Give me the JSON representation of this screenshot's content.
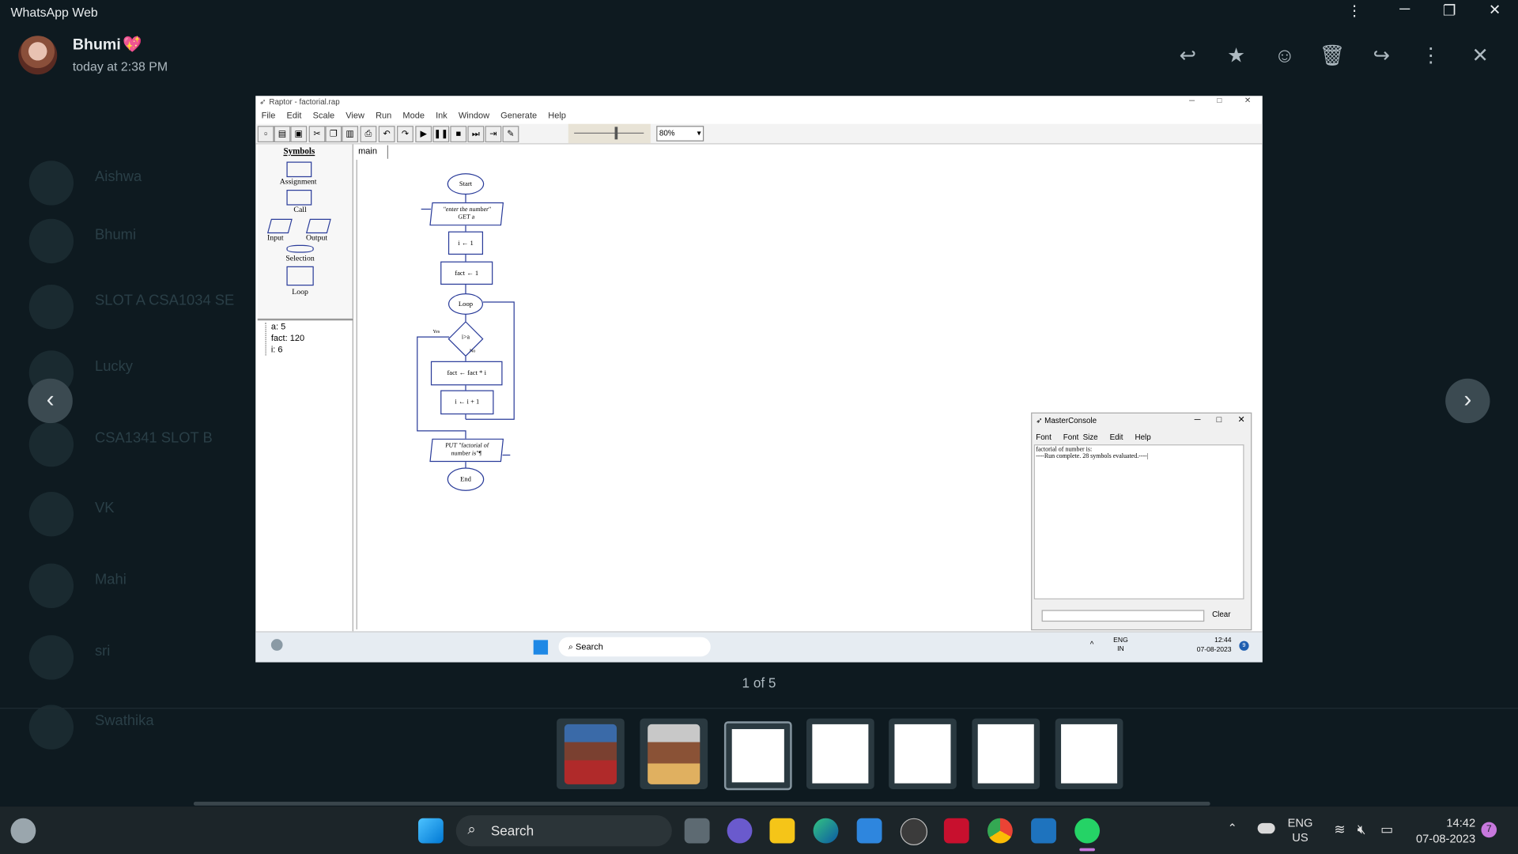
{
  "app": {
    "title": "WhatsApp Web"
  },
  "background_chats": [
    "Aishwa",
    "Bhumi",
    "SLOT A CSA1034 SE",
    "Lucky",
    "CSA1341 SLOT B",
    "VK",
    "Mahi",
    "sri",
    "Swathika"
  ],
  "header": {
    "sender_name": "Bhumi",
    "sender_emoji": "💖",
    "timestamp": "today at 2:38 PM",
    "actions": [
      {
        "name": "reply-icon",
        "glyph": "↩"
      },
      {
        "name": "star-icon",
        "glyph": "★"
      },
      {
        "name": "emoji-icon",
        "glyph": "☺"
      },
      {
        "name": "delete-icon",
        "glyph": "🗑"
      },
      {
        "name": "forward-icon",
        "glyph": "↪"
      },
      {
        "name": "more-icon",
        "glyph": "⋮"
      },
      {
        "name": "close-icon",
        "glyph": "✕"
      }
    ]
  },
  "window_controls": {
    "menu": "⋮",
    "minimize": "─",
    "maximize": "❐",
    "close": "✕"
  },
  "viewer": {
    "counter": "1 of 5",
    "prev": "‹",
    "next": "›"
  },
  "screenshot": {
    "title": "Raptor - factorial.rap",
    "menu": [
      "File",
      "Edit",
      "Scale",
      "View",
      "Run",
      "Mode",
      "Ink",
      "Window",
      "Generate",
      "Help"
    ],
    "zoom": "80%",
    "symbols": {
      "heading": "Symbols",
      "items": [
        "Assignment",
        "Call",
        "Input",
        "Output",
        "Selection",
        "Loop"
      ]
    },
    "variables": [
      "a: 5",
      "fact: 120",
      "i: 6"
    ],
    "tab": "main",
    "flowchart": {
      "start": "Start",
      "input_line1": "\"enter the number\"",
      "input_line2": "GET a",
      "assign1": "i ← 1",
      "assign2": "fact ← 1",
      "loop": "Loop",
      "condition": "i>a",
      "yes": "Yes",
      "no": "No",
      "assign3": "fact ← fact * i",
      "assign4": "i ← i + 1",
      "output_line1": "PUT \"factorial of",
      "output_line2": "number is\"¶",
      "end": "End"
    },
    "console": {
      "title": "MasterConsole",
      "menu": [
        "Font",
        "Font Size",
        "Edit",
        "Help"
      ],
      "line1": "factorial of number is:",
      "line2": "----Run complete.  28 symbols evaluated.----|",
      "clear": "Clear"
    },
    "taskbar": {
      "search": "Search",
      "lang1": "ENG",
      "lang2": "IN",
      "time": "12:44",
      "date": "07-08-2023",
      "badge": "9"
    }
  },
  "taskbar": {
    "search": "Search",
    "lang1": "ENG",
    "lang2": "US",
    "time": "14:42",
    "date": "07-08-2023",
    "notif": "7"
  },
  "colors": {
    "background": "#0e1a20",
    "accent": "#00a884",
    "flow_blue": "#2a3c9a"
  }
}
